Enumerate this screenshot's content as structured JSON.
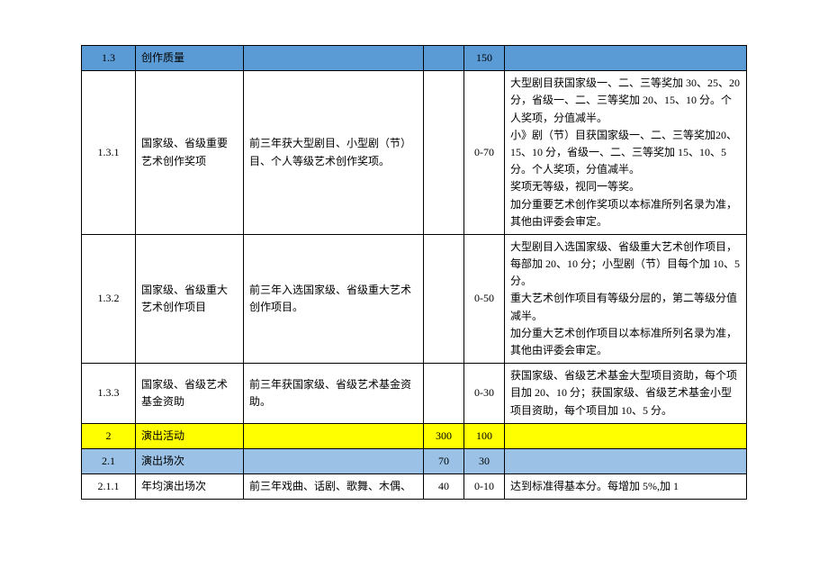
{
  "rows": [
    {
      "type": "header-blue",
      "num": "1.3",
      "name": "创作质量",
      "desc": "",
      "score1": "",
      "score2": "150",
      "detail": ""
    },
    {
      "type": "normal",
      "num": "1.3.1",
      "name": "国家级、省级重要艺术创作奖项",
      "desc": "前三年获大型剧目、小型剧（节）目、个人等级艺术创作奖项。",
      "score1": "",
      "score2": "0-70",
      "detail": "大型剧目获国家级一、二、三等奖加 30、25、20 分，省级一、二、三等奖加 20、15、10 分。个人奖项，分值减半。\n小》剧（节）目获国家级一、二、三等奖加20、15、10 分，省级一、二、三等奖加 15、10、5 分。个人奖项，分值减半。\n奖项无等级，视同一等奖。\n加分重要艺术创作奖项以本标准所列名录为准，其他由评委会审定。"
    },
    {
      "type": "normal",
      "num": "1.3.2",
      "name": "国家级、省级重大艺术创作项目",
      "desc": "前三年入选国家级、省级重大艺术创作项目。",
      "score1": "",
      "score2": "0-50",
      "detail": "大型剧目入选国家级、省级重大艺术创作项目，每部加 20、10 分；小型剧（节）目每个加 10、5 分。\n重大艺术创作项目有等级分层的，第二等级分值减半。\n加分重大艺术创作项目以本标准所列名录为准，其他由评委会审定。"
    },
    {
      "type": "normal",
      "num": "1.3.3",
      "name": "国家级、省级艺术基金资助",
      "desc": "前三年获国家级、省级艺术基金资助。",
      "score1": "",
      "score2": "0-30",
      "detail": "获国家级、省级艺术基金大型项目资助，每个项目加 20、10 分；获国家级、省级艺术基金小型项目资助，每个项目加 10、5 分。"
    },
    {
      "type": "header-yellow",
      "num": "2",
      "name": "演出活动",
      "desc": "",
      "score1": "300",
      "score2": "100",
      "detail": ""
    },
    {
      "type": "header-lightblue",
      "num": "2.1",
      "name": "演出场次",
      "desc": "",
      "score1": "70",
      "score2": "30",
      "detail": ""
    },
    {
      "type": "normal",
      "num": "2.1.1",
      "name": "年均演出场次",
      "desc": "前三年戏曲、话剧、歌舞、木偶、",
      "score1": "40",
      "score2": "0-10",
      "detail": "达到标准得基本分。每增加 5%,加 1"
    }
  ]
}
